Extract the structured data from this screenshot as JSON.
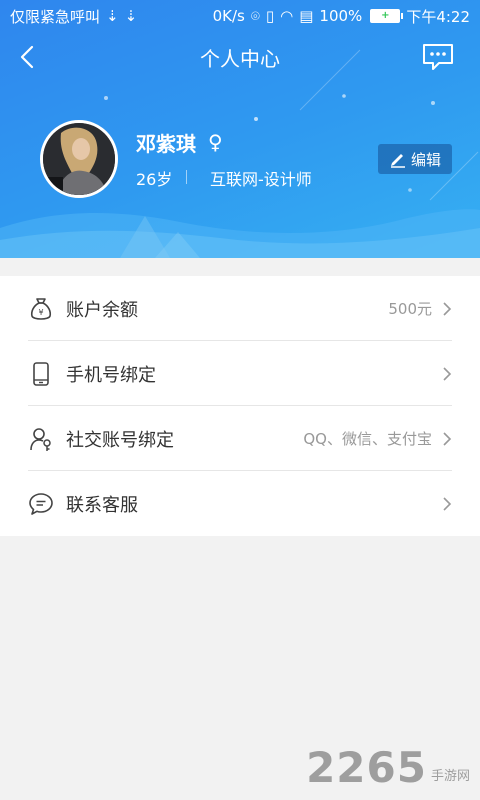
{
  "statusbar": {
    "left_text": "仅限紧急呼叫",
    "speed": "0K/s",
    "battery": "100%",
    "time": "下午4:22"
  },
  "nav": {
    "title": "个人中心"
  },
  "profile": {
    "name": "邓紫琪",
    "gender_symbol": "♀",
    "age": "26岁",
    "job": "互联网-设计师",
    "edit_label": "编辑"
  },
  "menu": {
    "items": [
      {
        "label": "账户余额",
        "value": "500元",
        "icon": "money-bag-icon"
      },
      {
        "label": "手机号绑定",
        "value": "",
        "icon": "phone-icon"
      },
      {
        "label": "社交账号绑定",
        "value": "QQ、微信、支付宝",
        "icon": "user-key-icon"
      },
      {
        "label": "联系客服",
        "value": "",
        "icon": "chat-icon"
      }
    ]
  },
  "watermark": {
    "num": "2265",
    "text": "手游网"
  },
  "colors": {
    "header_start": "#2f86ee",
    "header_end": "#36b0f2",
    "page_bg": "#f2f2f2"
  }
}
